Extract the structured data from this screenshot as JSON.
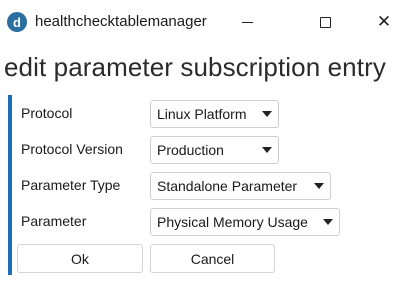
{
  "window": {
    "icon_letter": "d",
    "title": "healthchecktablemanager",
    "close_glyph": "✕"
  },
  "dialog": {
    "heading": "edit parameter subscription entry"
  },
  "form": {
    "fields": [
      {
        "label": "Protocol",
        "value": "Linux Platform"
      },
      {
        "label": "Protocol Version",
        "value": "Production"
      },
      {
        "label": "Parameter Type",
        "value": "Standalone Parameter"
      },
      {
        "label": "Parameter",
        "value": "Physical Memory Usage"
      }
    ]
  },
  "buttons": {
    "ok": "Ok",
    "cancel": "Cancel"
  },
  "colors": {
    "accent_bar": "#1e6eb4",
    "app_icon": "#2a6f9e"
  }
}
